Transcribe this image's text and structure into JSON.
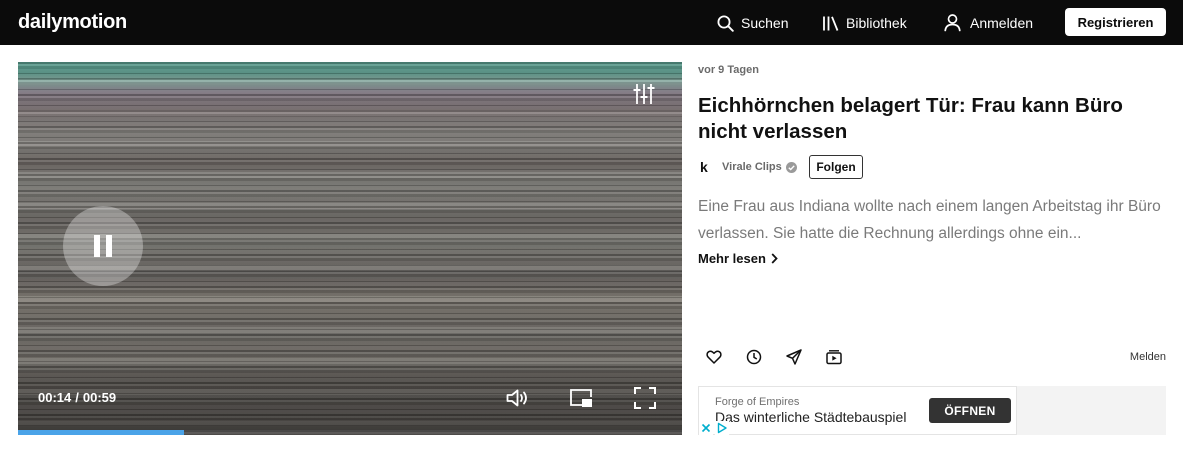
{
  "colors": {
    "header_bg": "#0b0b0b",
    "accent": "#4aa3e8",
    "ad_button": "#333333",
    "adchoices": "#00aecd"
  },
  "header": {
    "logo": "dailymotion",
    "search_label": "Suchen",
    "library_label": "Bibliothek",
    "login_label": "Anmelden",
    "register_label": "Registrieren",
    "icons": [
      "search-icon",
      "library-icon",
      "user-icon"
    ]
  },
  "player": {
    "current_time": "00:14",
    "time_separator": "/",
    "duration": "00:59",
    "progress": 0.25,
    "controls": [
      "pause-icon",
      "settings-icon",
      "volume-icon",
      "picture-in-picture-icon",
      "fullscreen-icon"
    ]
  },
  "video": {
    "age": "vor 9 Tagen",
    "title": "Eichhörnchen belagert Tür: Frau kann Büro nicht verlassen",
    "channel": {
      "avatar_letter": "k",
      "name": "Virale Clips",
      "verified": true
    },
    "follow_label": "Folgen",
    "description": "Eine Frau aus Indiana wollte nach einem langen Arbeitstag ihr Büro verlassen. Sie hatte die Rechnung allerdings ohne ein...",
    "more_label": "Mehr lesen"
  },
  "actions": {
    "icons": [
      "heart-icon",
      "clock-icon",
      "send-icon",
      "watch-later-icon"
    ],
    "report_label": "Melden"
  },
  "ad": {
    "advertiser": "Forge of Empires",
    "tagline": "Das winterliche Städtebauspiel",
    "cta": "ÖFFNEN",
    "icons": [
      "close-icon",
      "adchoices-icon"
    ]
  }
}
